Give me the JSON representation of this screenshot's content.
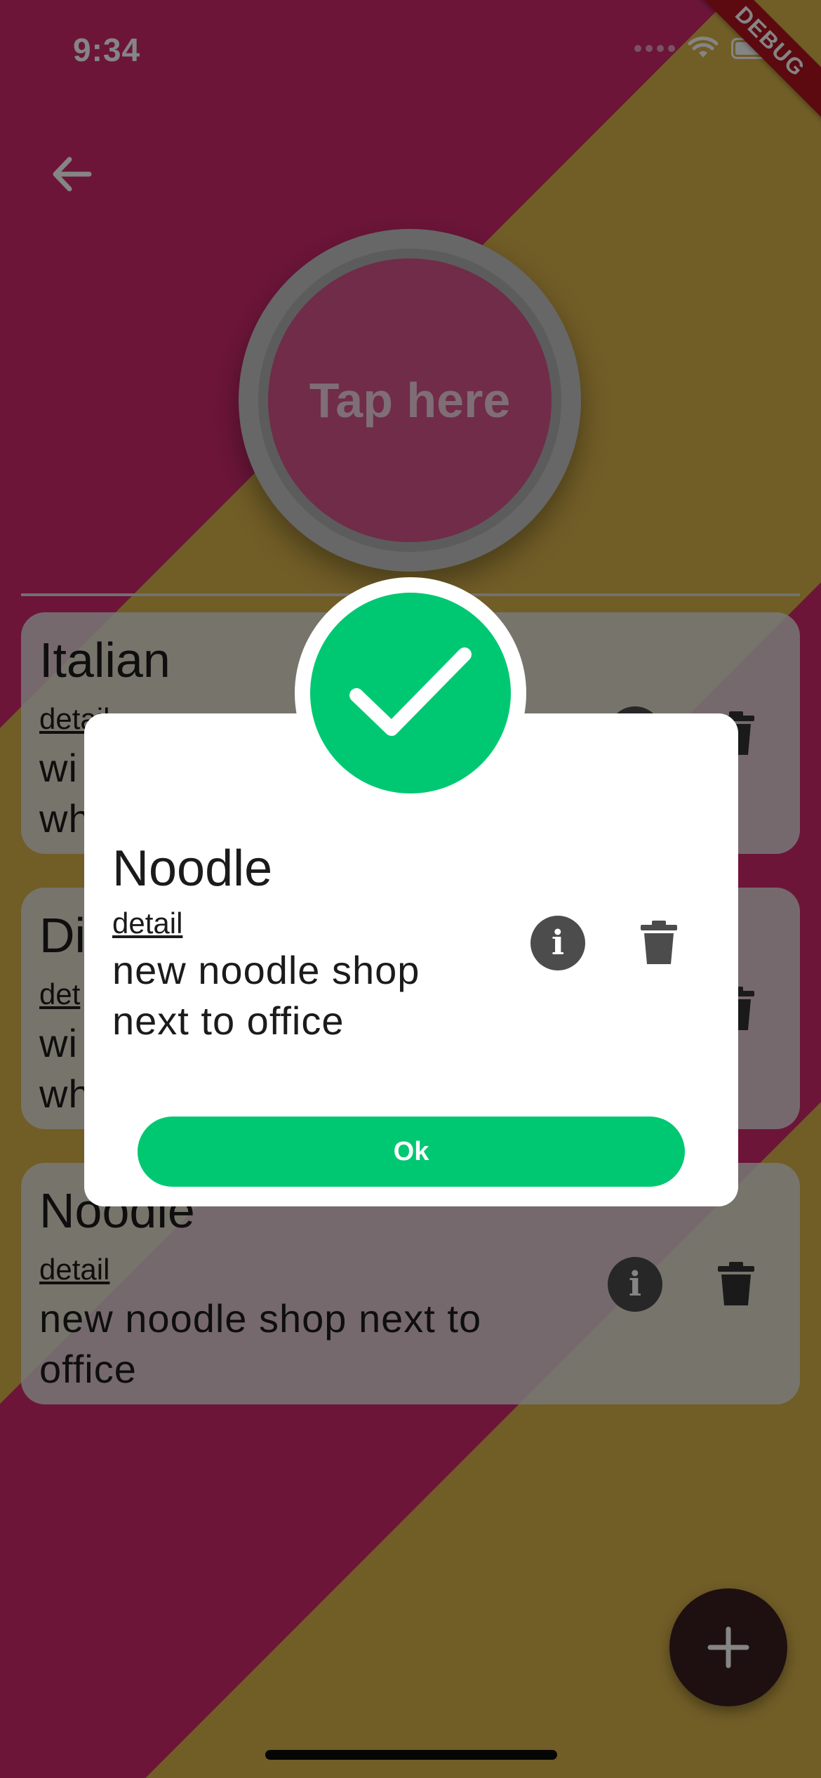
{
  "status_bar": {
    "time": "9:34",
    "debug_label": "DEBUG"
  },
  "header": {
    "back_icon": "arrow-left-icon"
  },
  "tap_button": {
    "label": "Tap here"
  },
  "cards": [
    {
      "title": "Italian",
      "detail_label": "detail",
      "description": "wi\nwh"
    },
    {
      "title": "Di",
      "detail_label": "det",
      "description": "wi\nwh"
    },
    {
      "title": "Noodle",
      "detail_label": "detail",
      "description": "new noodle shop next to office"
    }
  ],
  "dialog": {
    "title": "Noodle",
    "detail_label": "detail",
    "description": "new noodle shop next to office",
    "ok_label": "Ok",
    "success_icon": "checkmark-icon"
  },
  "icons": {
    "info": "info-icon",
    "delete": "trash-icon",
    "add": "plus-icon"
  },
  "colors": {
    "accent_green": "#00c872",
    "background_pink": "#cf2a6e",
    "background_gold": "#d8b24a",
    "fab": "#3b1f20",
    "debug_ribbon": "#b0131f"
  }
}
